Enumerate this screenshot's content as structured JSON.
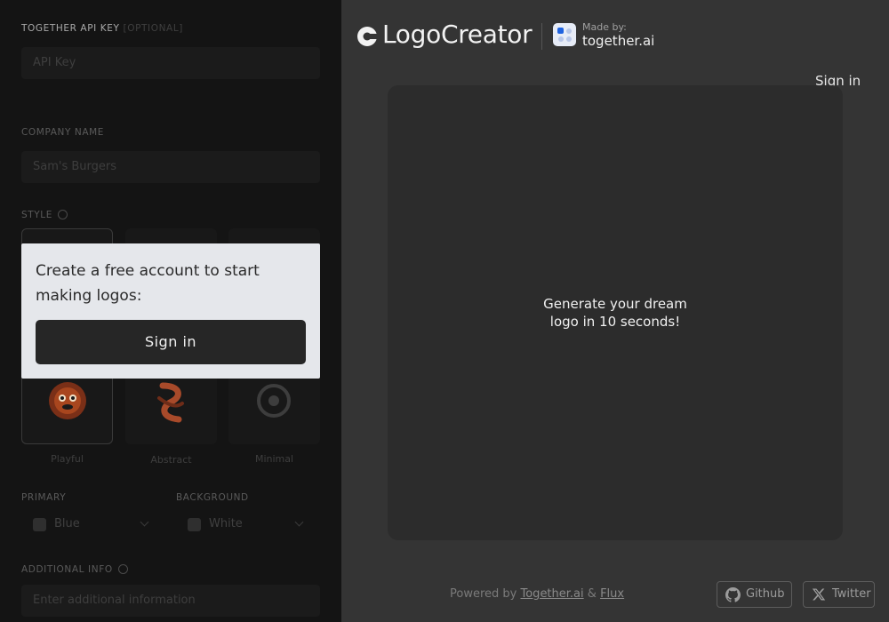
{
  "sidebar": {
    "api_key_label": "TOGETHER API KEY",
    "api_key_optional": "[OPTIONAL]",
    "api_key_placeholder": "API Key",
    "company_label": "COMPANY NAME",
    "company_value": "Sam's Burgers",
    "style_label": "STYLE",
    "styles": [
      {
        "name": "Playful"
      },
      {
        "name": "Abstract"
      },
      {
        "name": "Minimal"
      }
    ],
    "primary_label": "PRIMARY",
    "primary_value": "Blue",
    "background_label": "BACKGROUND",
    "background_value": "White",
    "additional_label": "ADDITIONAL INFO",
    "additional_placeholder": "Enter additional information"
  },
  "modal": {
    "text": "Create a free account to start making logos:",
    "button": "Sign in"
  },
  "header": {
    "brand": "LogoCreator",
    "made_by": "Made by:",
    "together": "together.ai",
    "sign_in": "Sign in"
  },
  "canvas": {
    "message": "Generate your dream\nlogo in 10 seconds!"
  },
  "footer": {
    "powered_prefix": "Powered by",
    "together_link": "Together.ai",
    "amp": "&",
    "flux_link": "Flux",
    "github": "Github",
    "twitter": "Twitter"
  },
  "colors": {
    "sidebar_bg": "#141414",
    "main_bg": "#343434",
    "modal_bg": "#e5e7eb",
    "canvas_bg": "#2c2c2c"
  }
}
